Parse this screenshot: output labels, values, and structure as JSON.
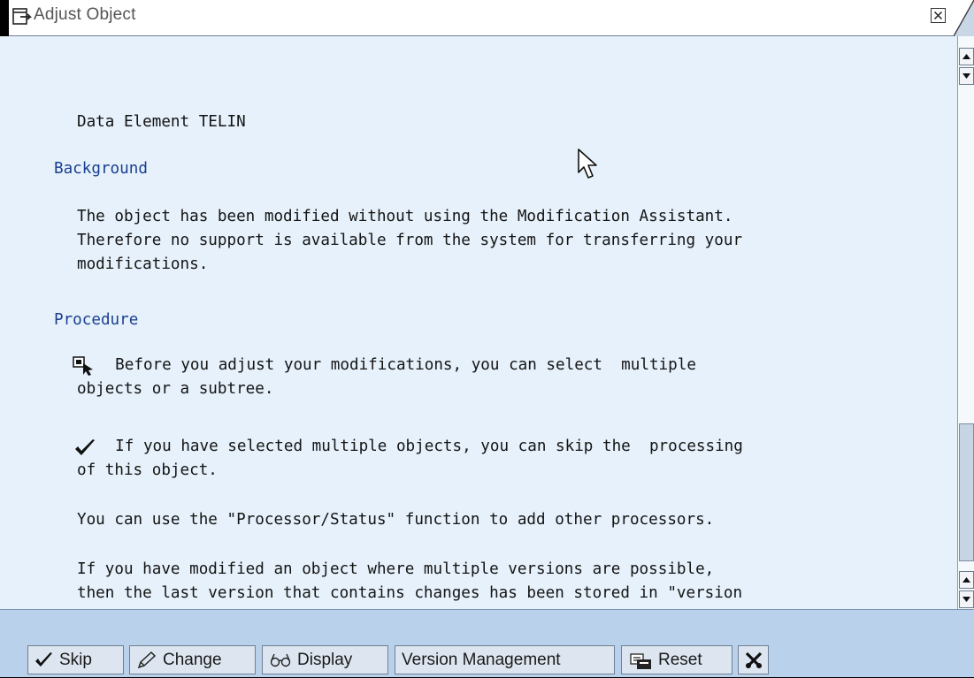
{
  "window": {
    "title": "Adjust Object"
  },
  "content": {
    "object_line": "Data Element TELIN",
    "background_heading": "Background",
    "background_lines": [
      "The object has been modified without using the Modification Assistant.",
      "Therefore no support is available from the system for transferring your",
      "modifications."
    ],
    "procedure_heading": "Procedure",
    "proc_select_line1": "  Before you adjust your modifications, you can select  multiple",
    "proc_select_line2": "objects or a subtree.",
    "proc_skip_line1": "  If you have selected multiple objects, you can skip the  processing",
    "proc_skip_line2": "of this object.",
    "proc_processor_line": "You can use the \"Processor/Status\" function to add other processors.",
    "proc_version_line1": "If you have modified an object where multiple versions are possible,",
    "proc_version_line2": "then the last version that contains changes has been stored in \"version"
  },
  "toolbar": {
    "skip_label": "Skip",
    "change_label": "Change",
    "display_label": "Display",
    "version_label": "Version Management",
    "reset_label": "Reset"
  },
  "icons": {
    "window": "window-icon",
    "close": "close-icon",
    "select": "select-icon",
    "check": "checkmark-icon",
    "pencil": "pencil-icon",
    "glasses": "glasses-icon",
    "reset": "reset-icon",
    "cancel": "cancel-icon"
  },
  "colors": {
    "heading": "#1a3f8f",
    "background": "#e6f1fb",
    "toolbar": "#b9d1ea"
  }
}
